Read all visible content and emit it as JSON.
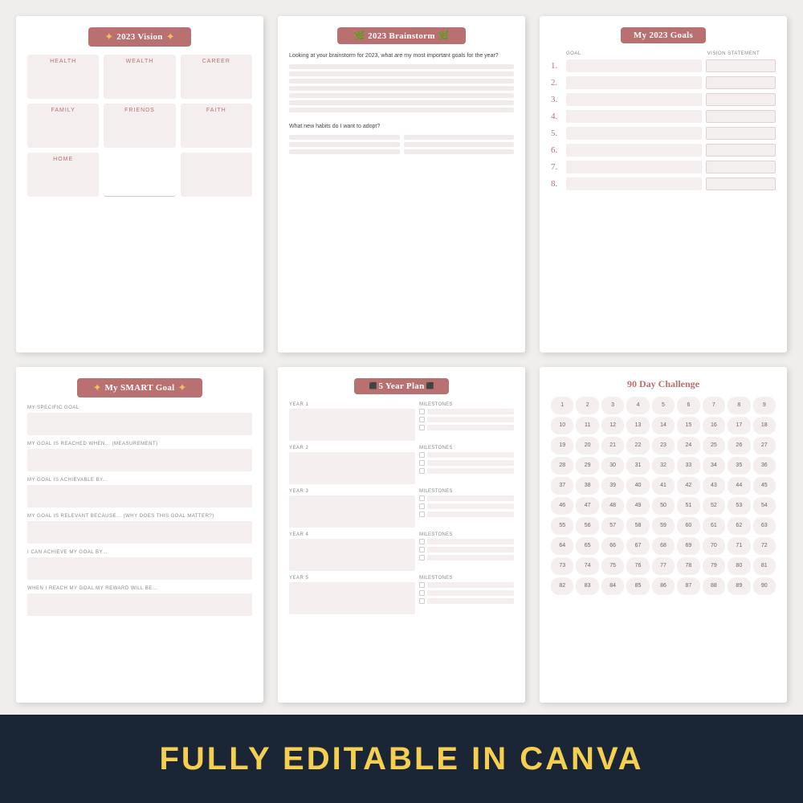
{
  "pages": [
    {
      "id": "vision",
      "title": "2023 Vision",
      "cells": [
        "HEALTH",
        "WEALTH",
        "CAREER",
        "FAMILY",
        "FRIENDS",
        "FAITH",
        "HOME"
      ]
    },
    {
      "id": "brainstorm",
      "title": "2023 Brainstorm",
      "question1": "Looking at your brainstorm for 2023, what are my most important goals for the year?",
      "question2": "What new habits do I want to adopt?"
    },
    {
      "id": "goals",
      "title": "My 2023 Goals",
      "col1": "GOAL",
      "col2": "VISION STATEMENT",
      "numbers": [
        "1.",
        "2.",
        "3.",
        "4.",
        "5.",
        "6.",
        "7.",
        "8."
      ]
    },
    {
      "id": "smart",
      "title": "My SMART Goal",
      "sections": [
        "MY SPECIFIC GOAL",
        "MY GOAL IS REACHED WHEN... (MEASUREMENT)",
        "MY GOAL IS ACHIEVABLE BY...",
        "MY GOAL IS RELEVANT BECAUSE... (WHY DOES THIS GOAL MATTER?)",
        "I CAN ACHIEVE MY GOAL BY...",
        "WHEN I REACH MY GOAL MY REWARD WILL BE..."
      ]
    },
    {
      "id": "yearplan",
      "title": "5 Year Plan",
      "years": [
        "YEAR 1",
        "YEAR 2",
        "YEAR 3",
        "YEAR 4",
        "YEAR 5"
      ]
    },
    {
      "id": "challenge",
      "title": "90 Day Challenge",
      "numbers": [
        1,
        2,
        3,
        4,
        5,
        6,
        7,
        8,
        9,
        10,
        11,
        12,
        13,
        14,
        15,
        16,
        17,
        18,
        19,
        20,
        21,
        22,
        23,
        24,
        25,
        26,
        27,
        28,
        29,
        30,
        31,
        32,
        33,
        34,
        35,
        36,
        37,
        38,
        39,
        40,
        41,
        42,
        43,
        44,
        45,
        46,
        47,
        48,
        49,
        50,
        51,
        52,
        53,
        54,
        55,
        56,
        57,
        58,
        59,
        60,
        61,
        62,
        63,
        64,
        65,
        66,
        67,
        68,
        69,
        70,
        71,
        72,
        73,
        74,
        75,
        76,
        77,
        78,
        79,
        80,
        81,
        82,
        83,
        84,
        85,
        86,
        87,
        88,
        89,
        90
      ]
    }
  ],
  "bottom_banner": "FULLY EDITABLE IN CANVA"
}
